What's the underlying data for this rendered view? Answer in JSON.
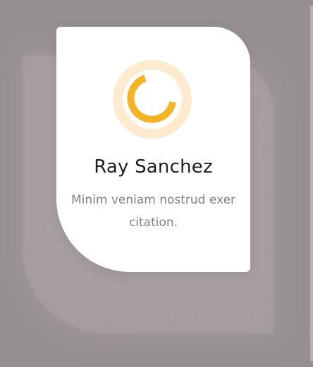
{
  "profile": {
    "name": "Ray Sanchez",
    "bio": "Minim veniam nostrud exer citation.",
    "avatar_icon": "loading-ring-icon",
    "accent_color": "#f3b426",
    "ring_background_color": "#fdebd0"
  }
}
